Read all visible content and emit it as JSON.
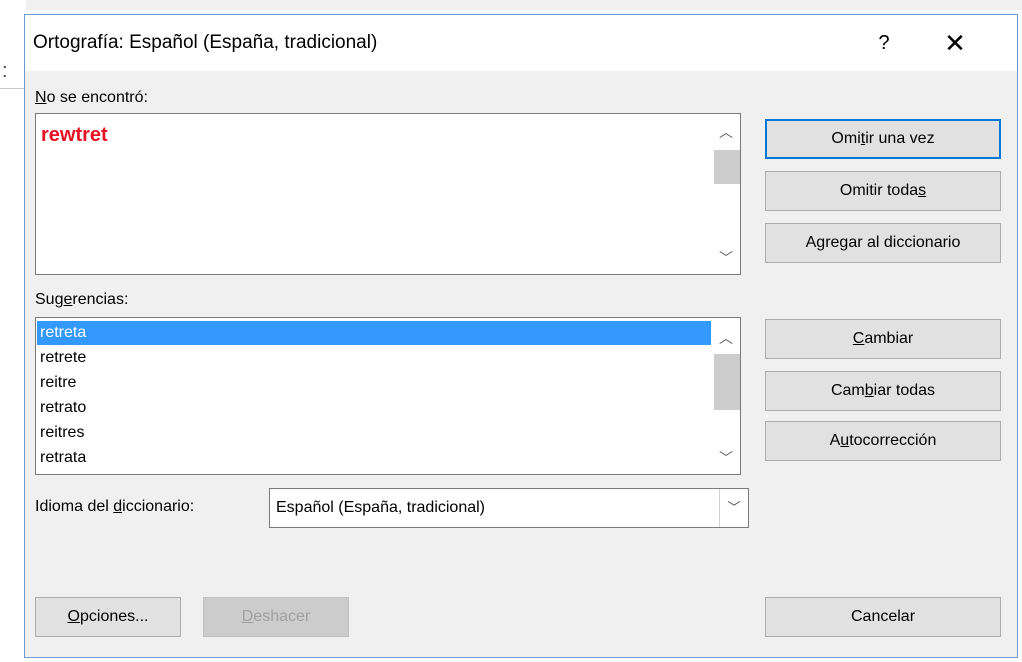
{
  "dialog": {
    "title": "Ortografía: Español (España, tradicional)",
    "help": "?",
    "close": "✕"
  },
  "not_found": {
    "label_prefix": "",
    "label_key": "N",
    "label_rest": "o se encontró:",
    "word": "rewtret"
  },
  "suggestions": {
    "label_prefix": "Sug",
    "label_key": "e",
    "label_rest": "rencias:",
    "items": [
      "retreta",
      "retrete",
      "reitre",
      "retrato",
      "reitres",
      "retrata"
    ],
    "selected_index": 0
  },
  "buttons": {
    "omit_once": {
      "pre": "Omi",
      "key": "t",
      "post": "ir una vez"
    },
    "omit_all": {
      "pre": "Omitir toda",
      "key": "s",
      "post": ""
    },
    "add_dict": {
      "pre": "A",
      "key": "g",
      "post": "regar al diccionario"
    },
    "change": {
      "pre": "",
      "key": "C",
      "post": "ambiar"
    },
    "change_all": {
      "pre": "Cam",
      "key": "b",
      "post": "iar todas"
    },
    "autocorrect": {
      "pre": "A",
      "key": "u",
      "post": "tocorrección"
    },
    "options": {
      "pre": "",
      "key": "O",
      "post": "pciones..."
    },
    "undo": {
      "pre": "",
      "key": "D",
      "post": "eshacer"
    },
    "cancel": {
      "label": "Cancelar"
    }
  },
  "dictionary": {
    "label_pre": "Idioma del ",
    "label_key": "d",
    "label_post": "iccionario:",
    "value": "Español (España, tradicional)"
  },
  "icons": {
    "scroll_up": "chevron-up-icon",
    "scroll_down": "chevron-down-icon",
    "dropdown": "chevron-down-icon"
  }
}
